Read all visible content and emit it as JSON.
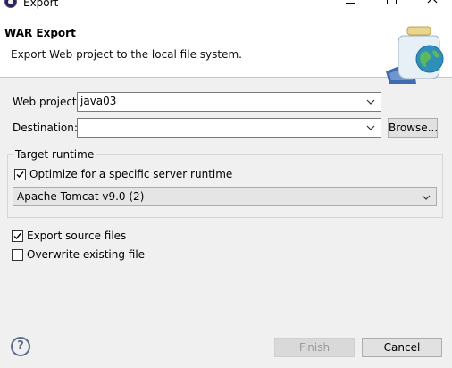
{
  "window": {
    "title": "Export",
    "icon": "eclipse-icon"
  },
  "header": {
    "title": "WAR Export",
    "description": "Export Web project to the local file system."
  },
  "form": {
    "web_project_label": "Web project:",
    "web_project_value": "java03",
    "destination_label": "Destination:",
    "destination_value": "",
    "browse_label": "Browse..."
  },
  "target_runtime": {
    "group_label": "Target runtime",
    "optimize_label": "Optimize for a specific server runtime",
    "optimize_checked": true,
    "runtime_value": "Apache Tomcat v9.0 (2)"
  },
  "options": {
    "export_source_label": "Export source files",
    "export_source_checked": true,
    "overwrite_label": "Overwrite existing file",
    "overwrite_checked": false
  },
  "footer": {
    "finish_label": "Finish",
    "cancel_label": "Cancel",
    "help_icon": "help-icon"
  }
}
